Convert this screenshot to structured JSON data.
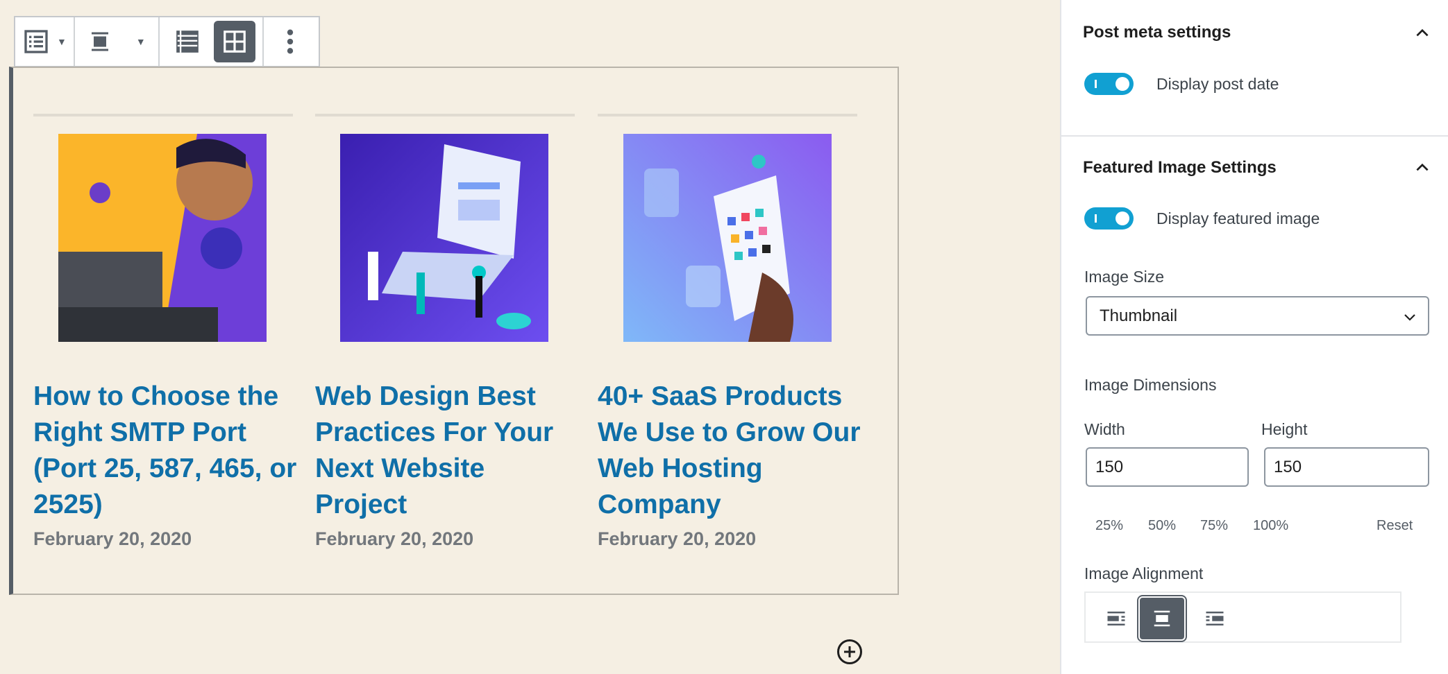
{
  "toolbar": {
    "icons": [
      "list-view-icon",
      "dropdown-arrow-icon",
      "align-center-icon",
      "dropdown-arrow-icon",
      "list-layout-icon",
      "grid-layout-icon",
      "more-options-icon"
    ],
    "active": "grid-layout-icon"
  },
  "posts": [
    {
      "title": "How to Choose the Right SMTP Port (Port 25, 587, 465, or 2525)",
      "date": "February 20, 2020"
    },
    {
      "title": "Web Design Best Practices For Your Next Website Project",
      "date": "February 20, 2020"
    },
    {
      "title": "40+ SaaS Products We Use to Grow Our Web Hosting Company",
      "date": "February 20, 2020"
    }
  ],
  "colors": {
    "accent": "#11a0d2",
    "link": "#0f6fa8",
    "background": "#f5efe3"
  },
  "sidebar": {
    "post_meta": {
      "title": "Post meta settings",
      "toggle_label": "Display post date",
      "toggle_on": true
    },
    "featured": {
      "title": "Featured Image Settings",
      "toggle_label": "Display featured image",
      "toggle_on": true,
      "image_size_label": "Image Size",
      "image_size_value": "Thumbnail",
      "dimensions_label": "Image Dimensions",
      "width_label": "Width",
      "height_label": "Height",
      "width_value": "150",
      "height_value": "150",
      "presets": [
        "25%",
        "50%",
        "75%",
        "100%"
      ],
      "reset": "Reset",
      "alignment_label": "Image Alignment",
      "alignment_selected": "center"
    }
  }
}
